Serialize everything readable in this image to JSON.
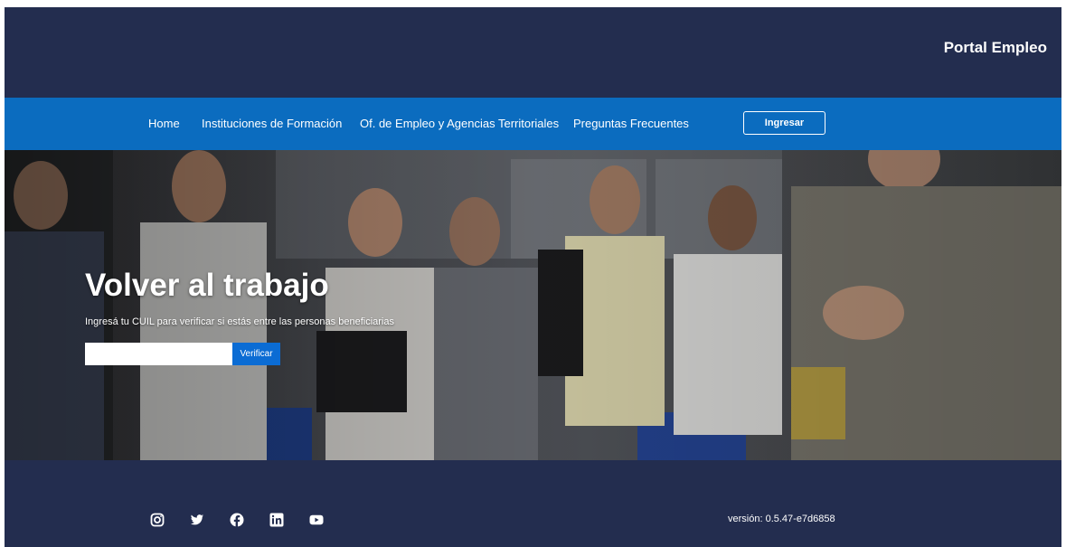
{
  "header": {
    "brand": "Portal Empleo"
  },
  "nav": {
    "items": [
      {
        "label": "Home"
      },
      {
        "label": "Instituciones de Formación"
      },
      {
        "label": "Of. de Empleo y Agencias Territoriales"
      },
      {
        "label": "Preguntas Frecuentes"
      }
    ],
    "login_label": "Ingresar"
  },
  "hero": {
    "title": "Volver al trabajo",
    "subtitle": "Ingresá tu CUIL para verificar si estás entre las personas beneficiarias",
    "input_value": "",
    "verify_label": "Verificar"
  },
  "footer": {
    "social_icons": [
      "instagram-icon",
      "twitter-icon",
      "facebook-icon",
      "linkedin-icon",
      "youtube-icon"
    ],
    "version": "versión: 0.5.47-e7d6858"
  },
  "colors": {
    "header_bg": "#232d4f",
    "nav_bg": "#0b6cbf",
    "button_blue": "#0b6cd4",
    "text": "#ffffff"
  }
}
